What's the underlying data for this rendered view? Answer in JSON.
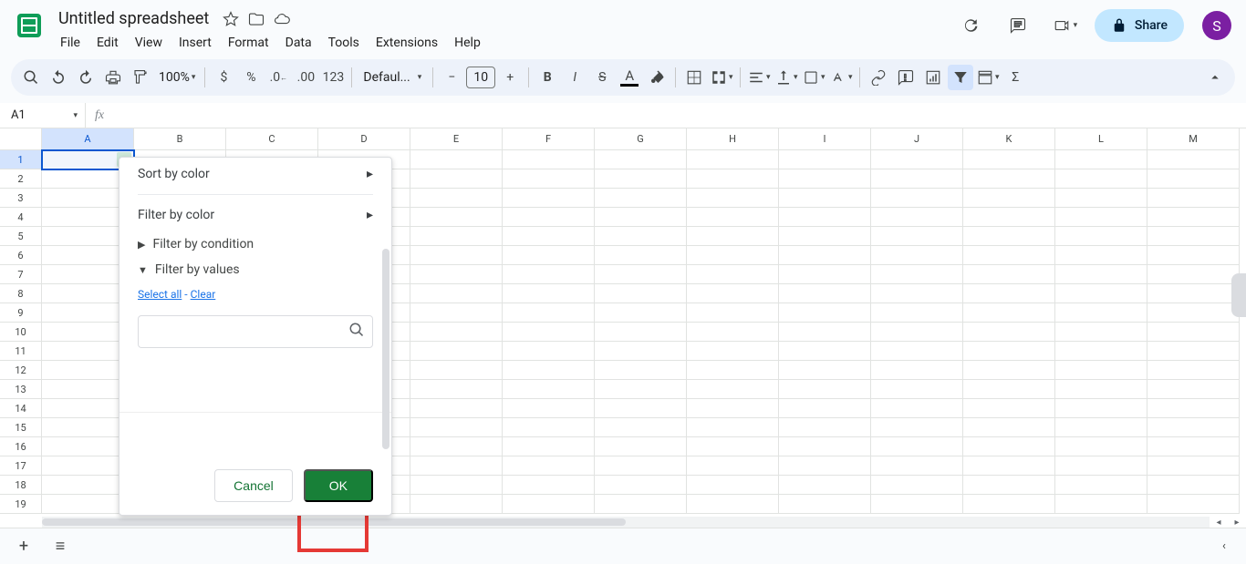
{
  "app": {
    "title": "Untitled spreadsheet",
    "menus": [
      "File",
      "Edit",
      "View",
      "Insert",
      "Format",
      "Data",
      "Tools",
      "Extensions",
      "Help"
    ],
    "share_label": "Share",
    "avatar_letter": "S"
  },
  "toolbar": {
    "zoom": "100%",
    "font_name": "Defaul...",
    "font_size": "10",
    "decimal_txt": "123"
  },
  "formula": {
    "name_box": "A1"
  },
  "grid": {
    "columns": [
      "A",
      "B",
      "C",
      "D",
      "E",
      "F",
      "G",
      "H",
      "I",
      "J",
      "K",
      "L",
      "M"
    ],
    "rows": [
      "1",
      "2",
      "3",
      "4",
      "5",
      "6",
      "7",
      "8",
      "9",
      "10",
      "11",
      "12",
      "13",
      "14",
      "15",
      "16",
      "17",
      "18",
      "19"
    ]
  },
  "popup": {
    "sort_by_color": "Sort by color",
    "filter_by_color": "Filter by color",
    "filter_by_condition": "Filter by condition",
    "filter_by_values": "Filter by values",
    "select_all": "Select all",
    "clear": "Clear",
    "cancel": "Cancel",
    "ok": "OK"
  }
}
